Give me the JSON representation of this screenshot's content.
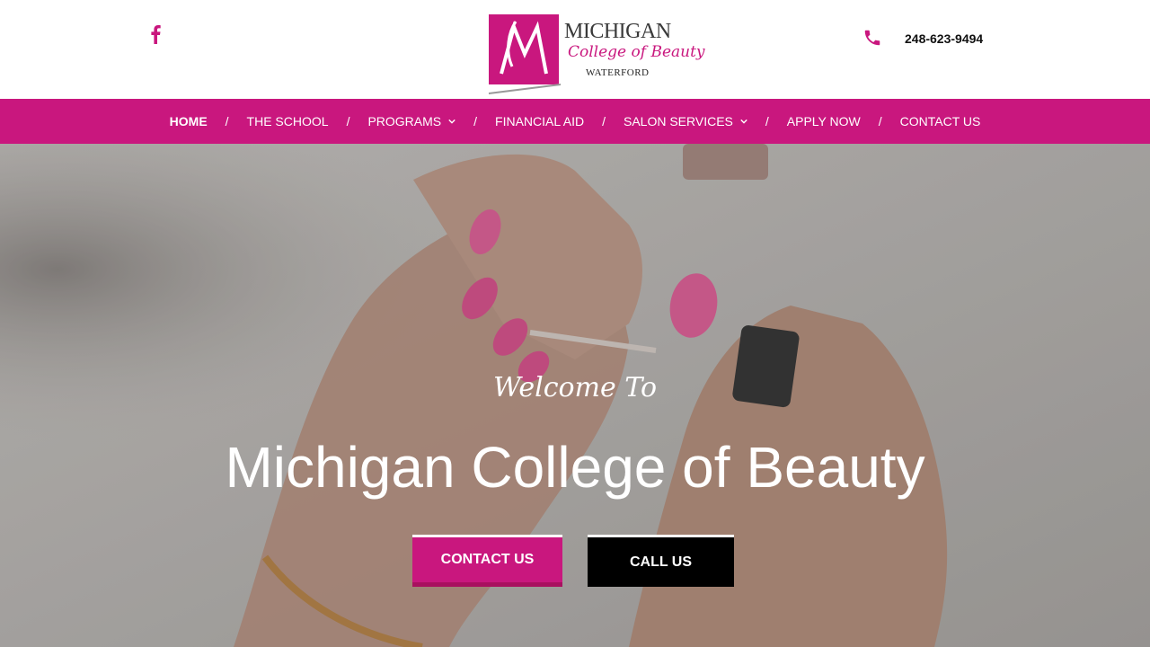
{
  "header": {
    "facebook_icon": "facebook-icon",
    "logo": {
      "line1": "MICHIGAN",
      "line2": "College of Beauty",
      "line3": "WATERFORD",
      "color": "#c9177e"
    },
    "phone_icon": "phone-icon",
    "phone": "248-623-9494"
  },
  "nav": {
    "separator": "/",
    "items": [
      {
        "label": "HOME",
        "active": true,
        "dropdown": false
      },
      {
        "label": "THE SCHOOL",
        "active": false,
        "dropdown": false
      },
      {
        "label": "PROGRAMS",
        "active": false,
        "dropdown": true
      },
      {
        "label": "FINANCIAL AID",
        "active": false,
        "dropdown": false
      },
      {
        "label": "SALON SERVICES",
        "active": false,
        "dropdown": true
      },
      {
        "label": "APPLY NOW",
        "active": false,
        "dropdown": false
      },
      {
        "label": "CONTACT US",
        "active": false,
        "dropdown": false
      }
    ],
    "color": "#c9177e"
  },
  "hero": {
    "welcome": "Welcome To",
    "title": "Michigan College of Beauty",
    "buttons": {
      "contact": "CONTACT US",
      "call": "CALL US"
    }
  }
}
